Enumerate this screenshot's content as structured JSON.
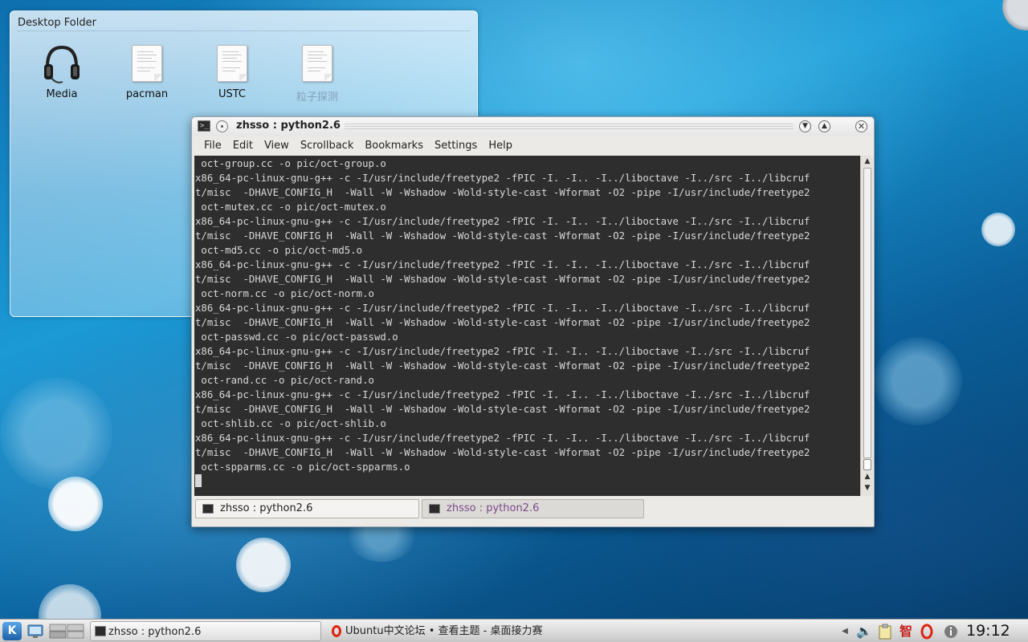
{
  "desktop_folder": {
    "title": "Desktop Folder",
    "icons": [
      {
        "label": "Media",
        "icon": "headphones-icon"
      },
      {
        "label": "pacman",
        "icon": "document-icon"
      },
      {
        "label": "USTC",
        "icon": "document-icon"
      },
      {
        "label": "粒子探测",
        "icon": "document-icon"
      }
    ]
  },
  "konsole": {
    "title": "zhsso : python2.6",
    "menu": [
      "File",
      "Edit",
      "View",
      "Scrollback",
      "Bookmarks",
      "Settings",
      "Help"
    ],
    "lines": [
      " oct-group.cc -o pic/oct-group.o",
      "x86_64-pc-linux-gnu-g++ -c -I/usr/include/freetype2 -fPIC -I. -I.. -I../liboctave -I../src -I../libcruf",
      "t/misc  -DHAVE_CONFIG_H  -Wall -W -Wshadow -Wold-style-cast -Wformat -O2 -pipe -I/usr/include/freetype2",
      " oct-mutex.cc -o pic/oct-mutex.o",
      "x86_64-pc-linux-gnu-g++ -c -I/usr/include/freetype2 -fPIC -I. -I.. -I../liboctave -I../src -I../libcruf",
      "t/misc  -DHAVE_CONFIG_H  -Wall -W -Wshadow -Wold-style-cast -Wformat -O2 -pipe -I/usr/include/freetype2",
      " oct-md5.cc -o pic/oct-md5.o",
      "x86_64-pc-linux-gnu-g++ -c -I/usr/include/freetype2 -fPIC -I. -I.. -I../liboctave -I../src -I../libcruf",
      "t/misc  -DHAVE_CONFIG_H  -Wall -W -Wshadow -Wold-style-cast -Wformat -O2 -pipe -I/usr/include/freetype2",
      " oct-norm.cc -o pic/oct-norm.o",
      "x86_64-pc-linux-gnu-g++ -c -I/usr/include/freetype2 -fPIC -I. -I.. -I../liboctave -I../src -I../libcruf",
      "t/misc  -DHAVE_CONFIG_H  -Wall -W -Wshadow -Wold-style-cast -Wformat -O2 -pipe -I/usr/include/freetype2",
      " oct-passwd.cc -o pic/oct-passwd.o",
      "x86_64-pc-linux-gnu-g++ -c -I/usr/include/freetype2 -fPIC -I. -I.. -I../liboctave -I../src -I../libcruf",
      "t/misc  -DHAVE_CONFIG_H  -Wall -W -Wshadow -Wold-style-cast -Wformat -O2 -pipe -I/usr/include/freetype2",
      " oct-rand.cc -o pic/oct-rand.o",
      "x86_64-pc-linux-gnu-g++ -c -I/usr/include/freetype2 -fPIC -I. -I.. -I../liboctave -I../src -I../libcruf",
      "t/misc  -DHAVE_CONFIG_H  -Wall -W -Wshadow -Wold-style-cast -Wformat -O2 -pipe -I/usr/include/freetype2",
      " oct-shlib.cc -o pic/oct-shlib.o",
      "x86_64-pc-linux-gnu-g++ -c -I/usr/include/freetype2 -fPIC -I. -I.. -I../liboctave -I../src -I../libcruf",
      "t/misc  -DHAVE_CONFIG_H  -Wall -W -Wshadow -Wold-style-cast -Wformat -O2 -pipe -I/usr/include/freetype2",
      " oct-spparms.cc -o pic/oct-spparms.o"
    ],
    "tabs": [
      {
        "label": "zhsso : python2.6",
        "active": true
      },
      {
        "label": "zhsso : python2.6",
        "active": false
      }
    ]
  },
  "taskbar": {
    "tasks": [
      {
        "label": "zhsso : python2.6",
        "icon": "terminal-icon"
      },
      {
        "label": "Ubuntu中文论坛 • 查看主题 - 桌面接力赛",
        "icon": "opera-icon"
      }
    ],
    "tray": [
      "volume-icon",
      "clipboard-icon",
      "ime-icon",
      "opera-icon",
      "info-icon"
    ],
    "tray_ime_char": "智",
    "clock": "19:12"
  },
  "colors": {
    "terminal_bg": "#2e2e2e",
    "terminal_fg": "#d8d8d8",
    "inactive_tab_text": "#7a4a8a"
  }
}
